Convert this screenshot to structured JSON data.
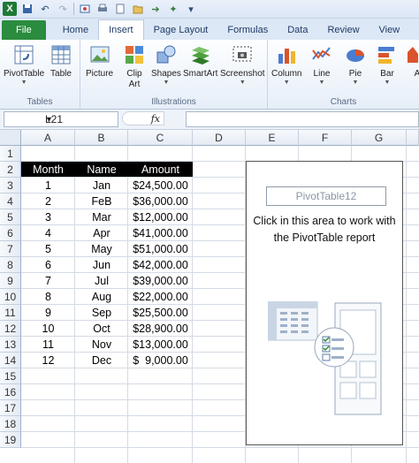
{
  "qat": {
    "app_icon": "X"
  },
  "tabs": [
    "File",
    "Home",
    "Insert",
    "Page Layout",
    "Formulas",
    "Data",
    "Review",
    "View"
  ],
  "ribbon": {
    "groups": {
      "tables": "Tables",
      "illustrations": "Illustrations",
      "charts": "Charts"
    },
    "buttons": {
      "pivottable": "PivotTable",
      "table": "Table",
      "picture": "Picture",
      "clipart_1": "Clip",
      "clipart_2": "Art",
      "shapes": "Shapes",
      "smartart": "SmartArt",
      "screenshot": "Screenshot",
      "column": "Column",
      "line": "Line",
      "pie": "Pie",
      "bar": "Bar",
      "area": "A"
    }
  },
  "formula_bar": {
    "name_box": "L21",
    "fx": "fx",
    "formula": ""
  },
  "columns": [
    "A",
    "B",
    "C",
    "D",
    "E",
    "F",
    "G"
  ],
  "rows": [
    "1",
    "2",
    "3",
    "4",
    "5",
    "6",
    "7",
    "8",
    "9",
    "10",
    "11",
    "12",
    "13",
    "14",
    "15",
    "16",
    "17",
    "18",
    "19"
  ],
  "table": {
    "headers": [
      "Month",
      "Name",
      "Amount"
    ],
    "rows": [
      [
        "1",
        "Jan",
        "$24,500.00"
      ],
      [
        "2",
        "FeB",
        "$36,000.00"
      ],
      [
        "3",
        "Mar",
        "$12,000.00"
      ],
      [
        "4",
        "Apr",
        "$41,000.00"
      ],
      [
        "5",
        "May",
        "$51,000.00"
      ],
      [
        "6",
        "Jun",
        "$42,000.00"
      ],
      [
        "7",
        "Jul",
        "$39,000.00"
      ],
      [
        "8",
        "Aug",
        "$22,000.00"
      ],
      [
        "9",
        "Sep",
        "$25,500.00"
      ],
      [
        "10",
        "Oct",
        "$28,900.00"
      ],
      [
        "11",
        "Nov",
        "$13,000.00"
      ],
      [
        "12",
        "Dec",
        "$  9,000.00"
      ]
    ]
  },
  "pivot": {
    "name": "PivotTable12",
    "line1": "Click in this area to work with",
    "line2": "the PivotTable report"
  },
  "colors": {
    "file_tab": "#2a8c3e",
    "header_fill": "#000000",
    "header_text": "#ffffff"
  }
}
